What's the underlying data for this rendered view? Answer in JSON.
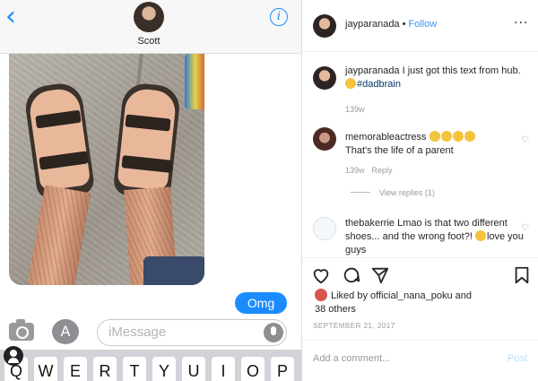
{
  "imessage": {
    "contact_name": "Scott",
    "info_label": "i",
    "back_label": "‹",
    "sent_message": "Omg",
    "input_placeholder": "iMessage",
    "apps_label": "A",
    "keyboard_keys": [
      "Q",
      "W",
      "E",
      "R",
      "T",
      "Y",
      "U",
      "I",
      "O",
      "P"
    ]
  },
  "instagram": {
    "header": {
      "username": "jayparanada",
      "separator": "•",
      "follow_label": "Follow",
      "more_label": "···"
    },
    "caption": {
      "username": "jayparanada",
      "text": "I just got this text from hub.",
      "hashtag": "#dadbrain",
      "time": "139w"
    },
    "comments": [
      {
        "username": "memorableactress",
        "text": "That's the life of a parent",
        "time": "139w",
        "reply_label": "Reply",
        "view_replies": "View replies (1)"
      },
      {
        "username": "thebakerrie",
        "text": "Lmao is that two different shoes... and the wrong foot?!",
        "text_after_emoji": "love you guys"
      }
    ],
    "likes": {
      "prefix": "Liked by",
      "user": "official_nana_poku",
      "suffix": "and",
      "others": "38 others"
    },
    "date": "SEPTEMBER 21, 2017",
    "add_comment_placeholder": "Add a comment...",
    "post_label": "Post"
  },
  "colors": {
    "imessage_blue": "#1a8cff",
    "instagram_link": "#3897f0",
    "hashtag": "#003569"
  }
}
